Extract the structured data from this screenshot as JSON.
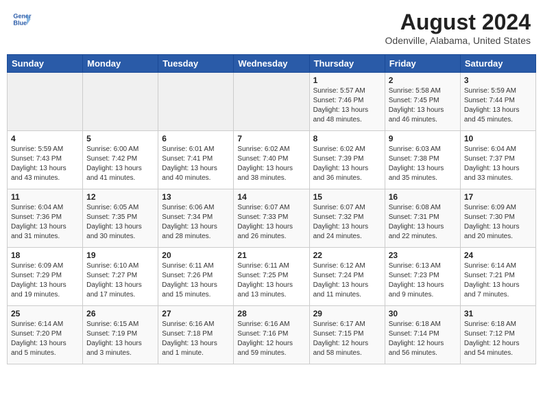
{
  "header": {
    "logo_line1": "General",
    "logo_line2": "Blue",
    "main_title": "August 2024",
    "subtitle": "Odenville, Alabama, United States"
  },
  "calendar": {
    "days_of_week": [
      "Sunday",
      "Monday",
      "Tuesday",
      "Wednesday",
      "Thursday",
      "Friday",
      "Saturday"
    ],
    "weeks": [
      [
        {
          "day": "",
          "info": ""
        },
        {
          "day": "",
          "info": ""
        },
        {
          "day": "",
          "info": ""
        },
        {
          "day": "",
          "info": ""
        },
        {
          "day": "1",
          "info": "Sunrise: 5:57 AM\nSunset: 7:46 PM\nDaylight: 13 hours\nand 48 minutes."
        },
        {
          "day": "2",
          "info": "Sunrise: 5:58 AM\nSunset: 7:45 PM\nDaylight: 13 hours\nand 46 minutes."
        },
        {
          "day": "3",
          "info": "Sunrise: 5:59 AM\nSunset: 7:44 PM\nDaylight: 13 hours\nand 45 minutes."
        }
      ],
      [
        {
          "day": "4",
          "info": "Sunrise: 5:59 AM\nSunset: 7:43 PM\nDaylight: 13 hours\nand 43 minutes."
        },
        {
          "day": "5",
          "info": "Sunrise: 6:00 AM\nSunset: 7:42 PM\nDaylight: 13 hours\nand 41 minutes."
        },
        {
          "day": "6",
          "info": "Sunrise: 6:01 AM\nSunset: 7:41 PM\nDaylight: 13 hours\nand 40 minutes."
        },
        {
          "day": "7",
          "info": "Sunrise: 6:02 AM\nSunset: 7:40 PM\nDaylight: 13 hours\nand 38 minutes."
        },
        {
          "day": "8",
          "info": "Sunrise: 6:02 AM\nSunset: 7:39 PM\nDaylight: 13 hours\nand 36 minutes."
        },
        {
          "day": "9",
          "info": "Sunrise: 6:03 AM\nSunset: 7:38 PM\nDaylight: 13 hours\nand 35 minutes."
        },
        {
          "day": "10",
          "info": "Sunrise: 6:04 AM\nSunset: 7:37 PM\nDaylight: 13 hours\nand 33 minutes."
        }
      ],
      [
        {
          "day": "11",
          "info": "Sunrise: 6:04 AM\nSunset: 7:36 PM\nDaylight: 13 hours\nand 31 minutes."
        },
        {
          "day": "12",
          "info": "Sunrise: 6:05 AM\nSunset: 7:35 PM\nDaylight: 13 hours\nand 30 minutes."
        },
        {
          "day": "13",
          "info": "Sunrise: 6:06 AM\nSunset: 7:34 PM\nDaylight: 13 hours\nand 28 minutes."
        },
        {
          "day": "14",
          "info": "Sunrise: 6:07 AM\nSunset: 7:33 PM\nDaylight: 13 hours\nand 26 minutes."
        },
        {
          "day": "15",
          "info": "Sunrise: 6:07 AM\nSunset: 7:32 PM\nDaylight: 13 hours\nand 24 minutes."
        },
        {
          "day": "16",
          "info": "Sunrise: 6:08 AM\nSunset: 7:31 PM\nDaylight: 13 hours\nand 22 minutes."
        },
        {
          "day": "17",
          "info": "Sunrise: 6:09 AM\nSunset: 7:30 PM\nDaylight: 13 hours\nand 20 minutes."
        }
      ],
      [
        {
          "day": "18",
          "info": "Sunrise: 6:09 AM\nSunset: 7:29 PM\nDaylight: 13 hours\nand 19 minutes."
        },
        {
          "day": "19",
          "info": "Sunrise: 6:10 AM\nSunset: 7:27 PM\nDaylight: 13 hours\nand 17 minutes."
        },
        {
          "day": "20",
          "info": "Sunrise: 6:11 AM\nSunset: 7:26 PM\nDaylight: 13 hours\nand 15 minutes."
        },
        {
          "day": "21",
          "info": "Sunrise: 6:11 AM\nSunset: 7:25 PM\nDaylight: 13 hours\nand 13 minutes."
        },
        {
          "day": "22",
          "info": "Sunrise: 6:12 AM\nSunset: 7:24 PM\nDaylight: 13 hours\nand 11 minutes."
        },
        {
          "day": "23",
          "info": "Sunrise: 6:13 AM\nSunset: 7:23 PM\nDaylight: 13 hours\nand 9 minutes."
        },
        {
          "day": "24",
          "info": "Sunrise: 6:14 AM\nSunset: 7:21 PM\nDaylight: 13 hours\nand 7 minutes."
        }
      ],
      [
        {
          "day": "25",
          "info": "Sunrise: 6:14 AM\nSunset: 7:20 PM\nDaylight: 13 hours\nand 5 minutes."
        },
        {
          "day": "26",
          "info": "Sunrise: 6:15 AM\nSunset: 7:19 PM\nDaylight: 13 hours\nand 3 minutes."
        },
        {
          "day": "27",
          "info": "Sunrise: 6:16 AM\nSunset: 7:18 PM\nDaylight: 13 hours\nand 1 minute."
        },
        {
          "day": "28",
          "info": "Sunrise: 6:16 AM\nSunset: 7:16 PM\nDaylight: 12 hours\nand 59 minutes."
        },
        {
          "day": "29",
          "info": "Sunrise: 6:17 AM\nSunset: 7:15 PM\nDaylight: 12 hours\nand 58 minutes."
        },
        {
          "day": "30",
          "info": "Sunrise: 6:18 AM\nSunset: 7:14 PM\nDaylight: 12 hours\nand 56 minutes."
        },
        {
          "day": "31",
          "info": "Sunrise: 6:18 AM\nSunset: 7:12 PM\nDaylight: 12 hours\nand 54 minutes."
        }
      ]
    ]
  }
}
